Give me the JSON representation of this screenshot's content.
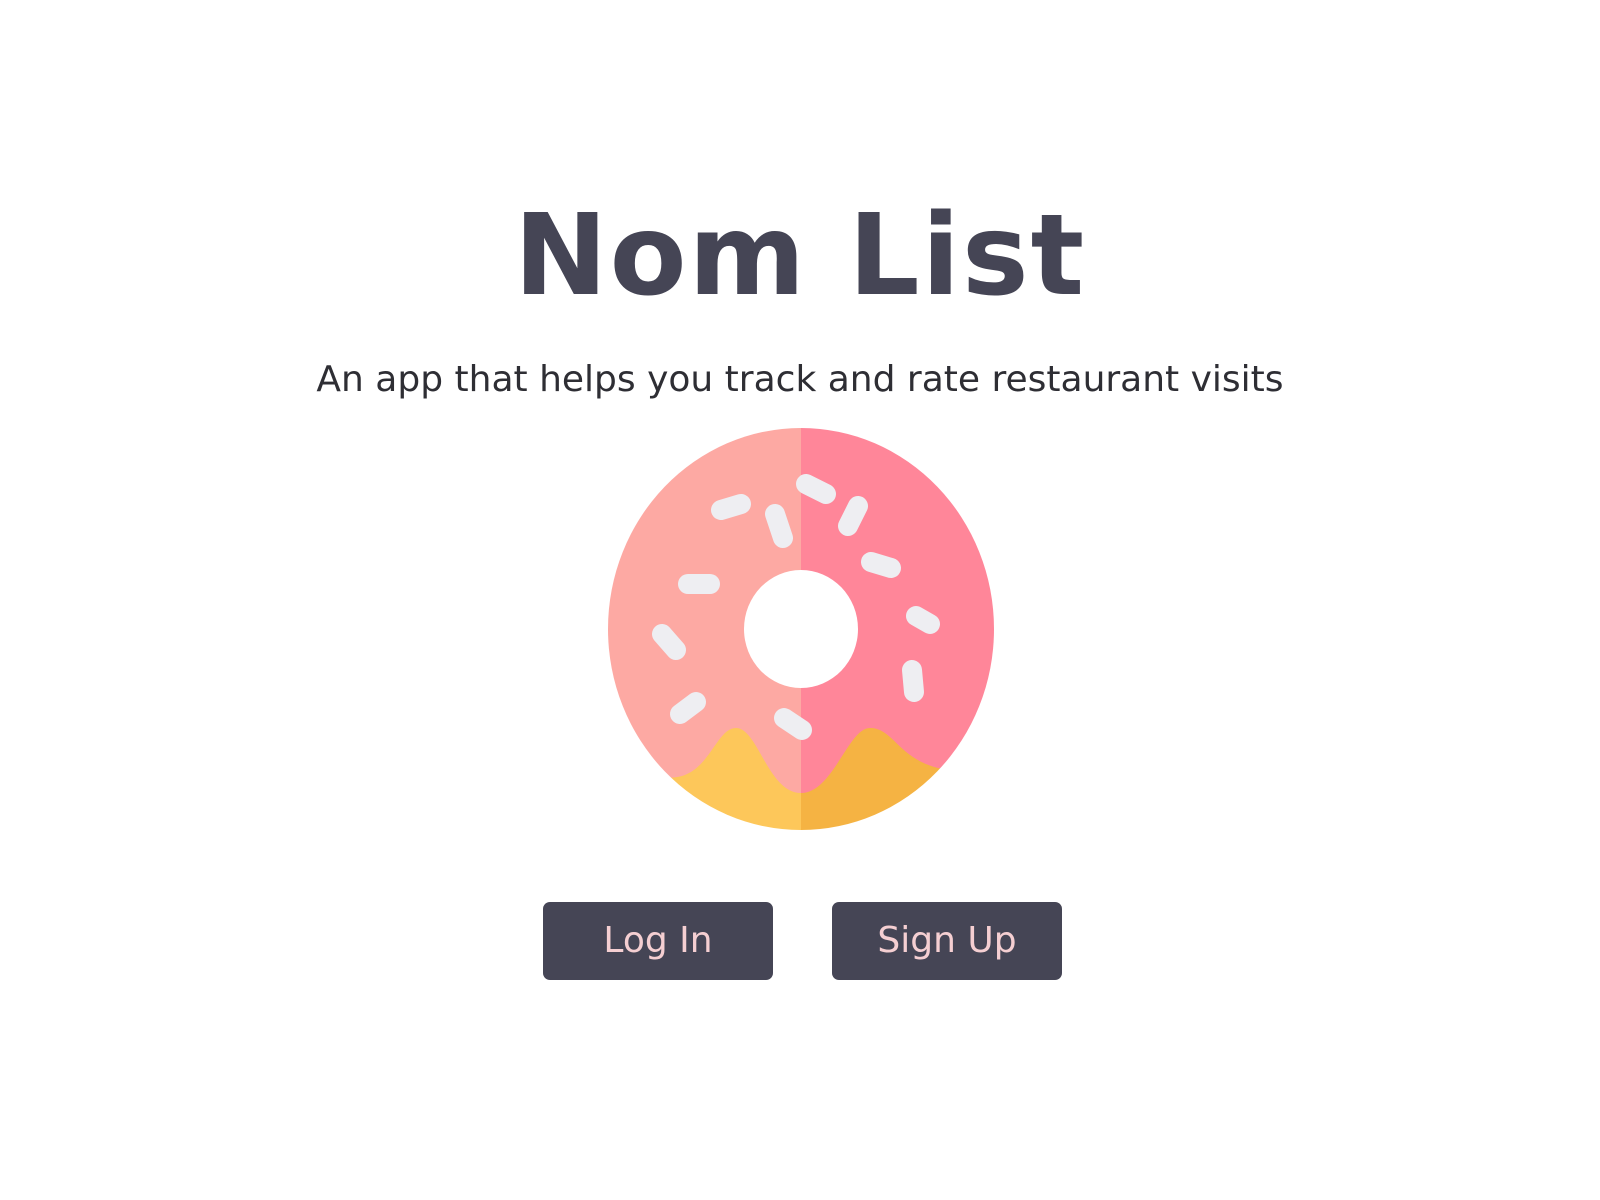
{
  "app": {
    "title": "Nom List",
    "tagline": "An app that helps you track and rate restaurant visits"
  },
  "logo": {
    "icon": "donut-icon",
    "colors": {
      "frosting_light": "#FDA9A3",
      "frosting_dark": "#FF8699",
      "dough_light": "#FDC75A",
      "dough_dark": "#F5B343",
      "sprinkle": "#EEEEF2"
    }
  },
  "actions": {
    "login_label": "Log In",
    "signup_label": "Sign Up"
  },
  "theme": {
    "button_bg": "#454555",
    "button_text": "#F5CFD2",
    "heading": "#454555"
  }
}
